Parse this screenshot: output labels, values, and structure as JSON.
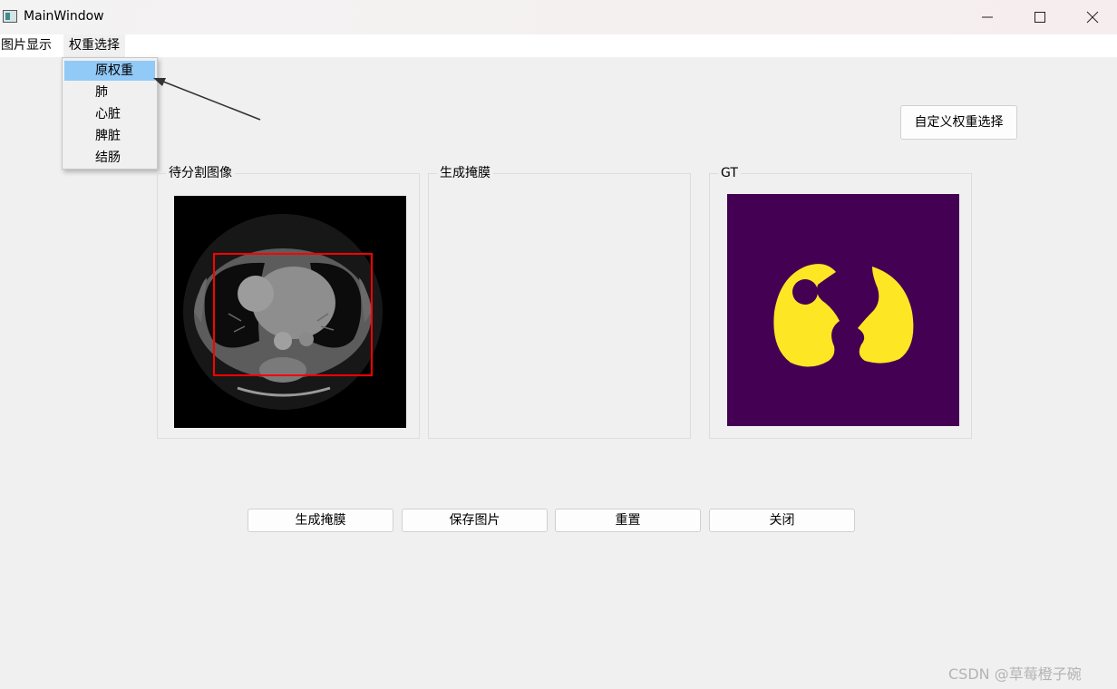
{
  "window": {
    "title": "MainWindow"
  },
  "menubar": {
    "items": [
      "图片显示",
      "权重选择"
    ]
  },
  "weights_menu": {
    "items": [
      "原权重",
      "肺",
      "心脏",
      "脾脏",
      "结肠"
    ],
    "selected": "原权重"
  },
  "custom_weight_button": "自定义权重选择",
  "panels": {
    "input_title": "待分割图像",
    "mask_title": "生成掩膜",
    "gt_title": "GT"
  },
  "buttons": {
    "generate": "生成掩膜",
    "save": "保存图片",
    "reset": "重置",
    "close": "关闭"
  },
  "watermark": "CSDN @草莓橙子碗",
  "colors": {
    "menu_highlight": "#91c9f7",
    "gt_background": "#440154",
    "gt_foreground": "#fde725",
    "bbox": "#ff0000"
  }
}
